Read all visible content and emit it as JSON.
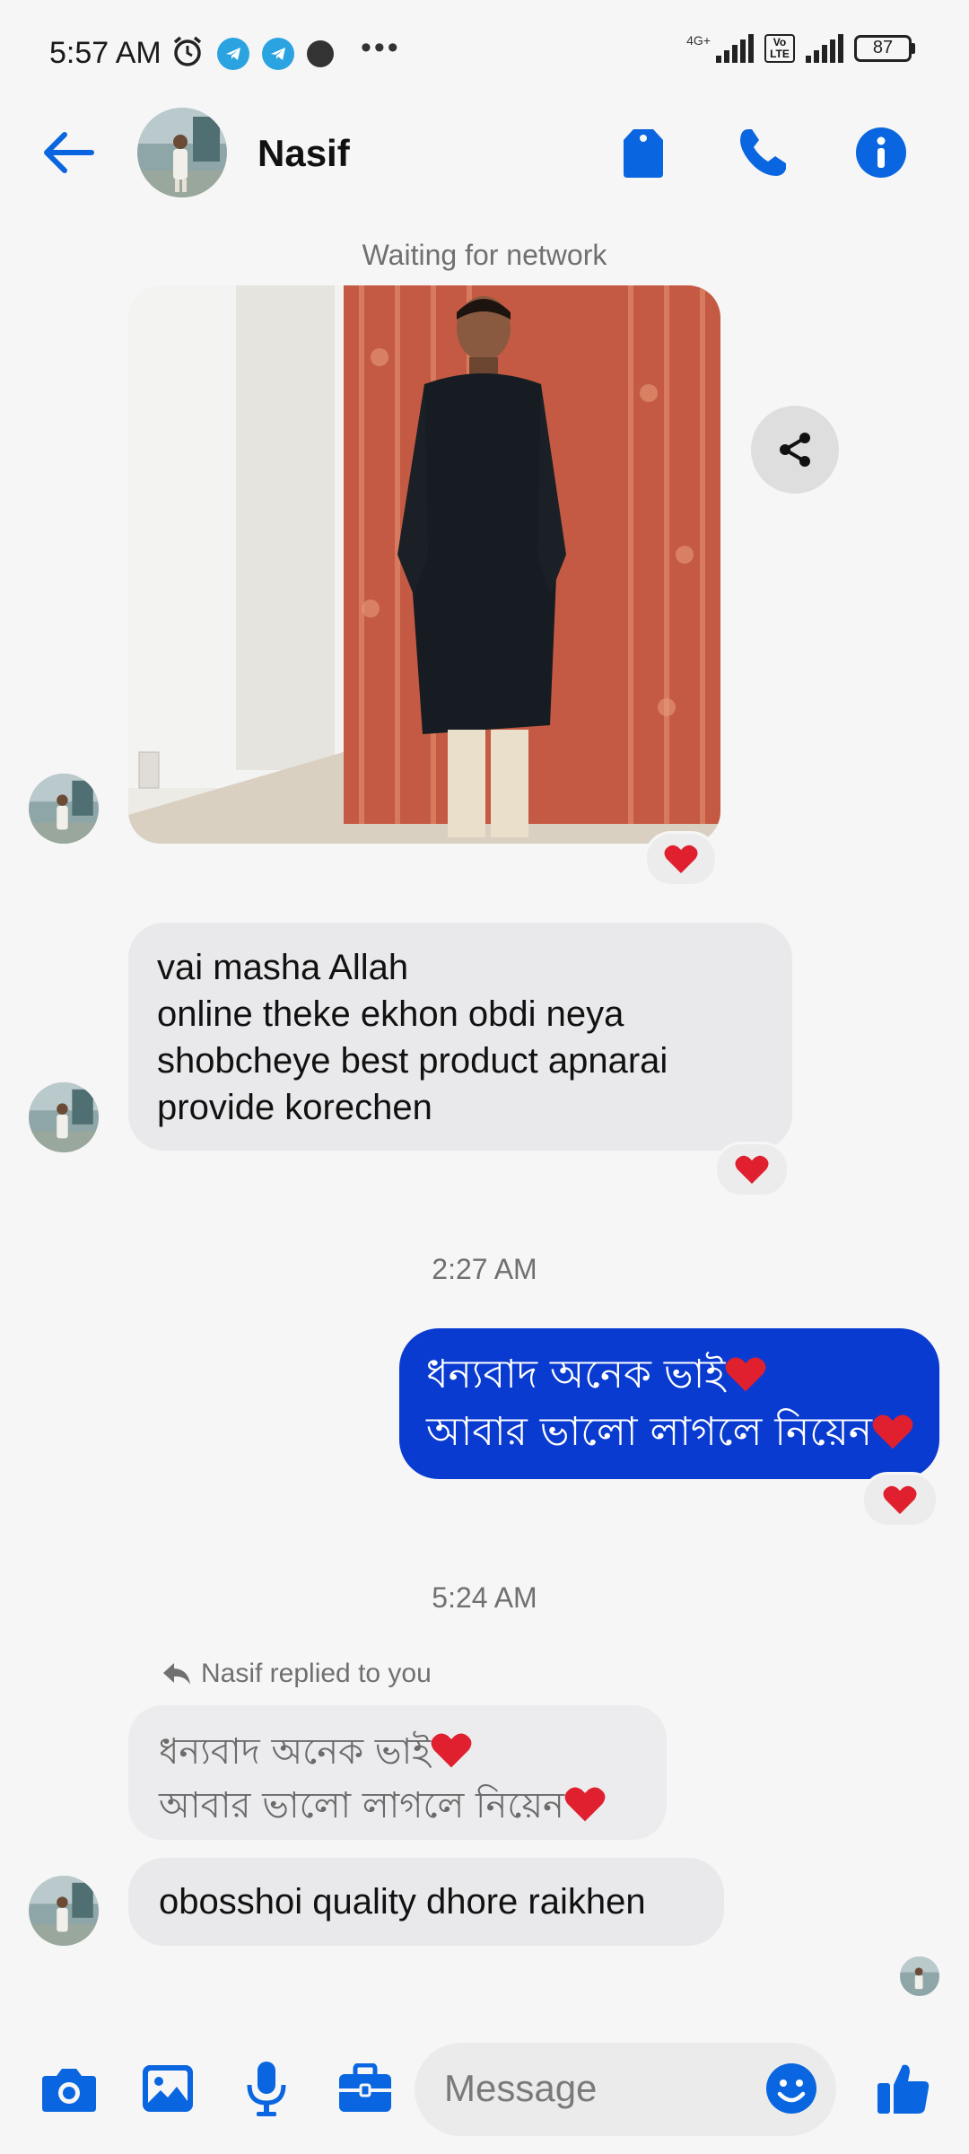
{
  "status_bar": {
    "time": "5:57 AM",
    "network": "4G+",
    "volte": "Vo LTE",
    "battery": "87",
    "icons": [
      "alarm-icon",
      "telegram-icon",
      "telegram-icon",
      "app-icon",
      "more-dots-icon"
    ]
  },
  "header": {
    "contact_name": "Nasif",
    "buttons": [
      "back-arrow-icon",
      "tag-icon",
      "phone-icon",
      "info-icon"
    ]
  },
  "messages": {
    "network_status": "Waiting for network",
    "incoming_1": {
      "lines": [
        "vai masha Allah",
        "online theke ekhon obdi neya",
        "shobcheye best product apnarai",
        "provide korechen"
      ]
    },
    "time_1": "2:27 AM",
    "outgoing_1": {
      "lines": [
        "ধন্যবাদ অনেক ভাই",
        "আবার ভালো লাগলে নিয়েন"
      ]
    },
    "time_2": "5:24 AM",
    "reply_note": "Nasif replied to you",
    "quoted": {
      "lines": [
        "ধন্যবাদ অনেক ভাই",
        "আবার ভালো লাগলে নিয়েন"
      ]
    },
    "incoming_2": "obosshoi quality dhore raikhen",
    "reaction": "heart"
  },
  "composer": {
    "placeholder": "Message",
    "buttons": [
      "camera-icon",
      "gallery-icon",
      "microphone-icon",
      "briefcase-icon",
      "emoji-icon",
      "thumbs-up-icon"
    ]
  },
  "colors": {
    "accent": "#0a66e0",
    "outgoing_bubble": "#0a3bd0",
    "incoming_bubble": "#e9e9eb",
    "heart": "#e0202f"
  }
}
